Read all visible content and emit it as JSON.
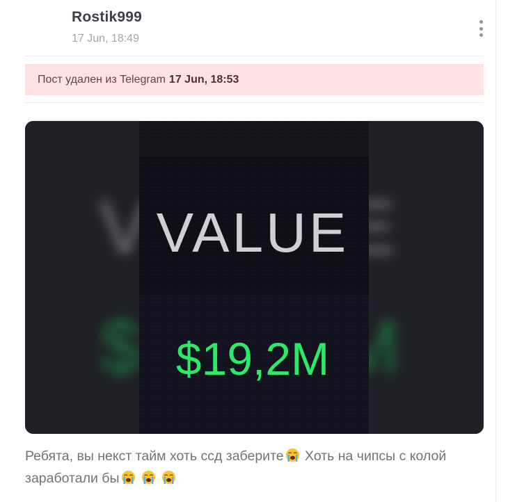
{
  "post": {
    "author": "Rostik999",
    "time": "17 Jun, 18:49",
    "deleted_notice": {
      "text": "Пост удален из Telegram",
      "time": "17 Jun, 18:53"
    },
    "media": {
      "heading": "VALUE",
      "amount": "$19,2M",
      "heading_color": "#cfd0d4",
      "amount_color": "#2ee86a"
    },
    "caption": {
      "part1": "Ребята, вы некст тайм хоть ссд заберите",
      "part2": "Хоть на чипсы с колой заработали бы"
    },
    "emoji_name": "loudly-crying-face"
  }
}
